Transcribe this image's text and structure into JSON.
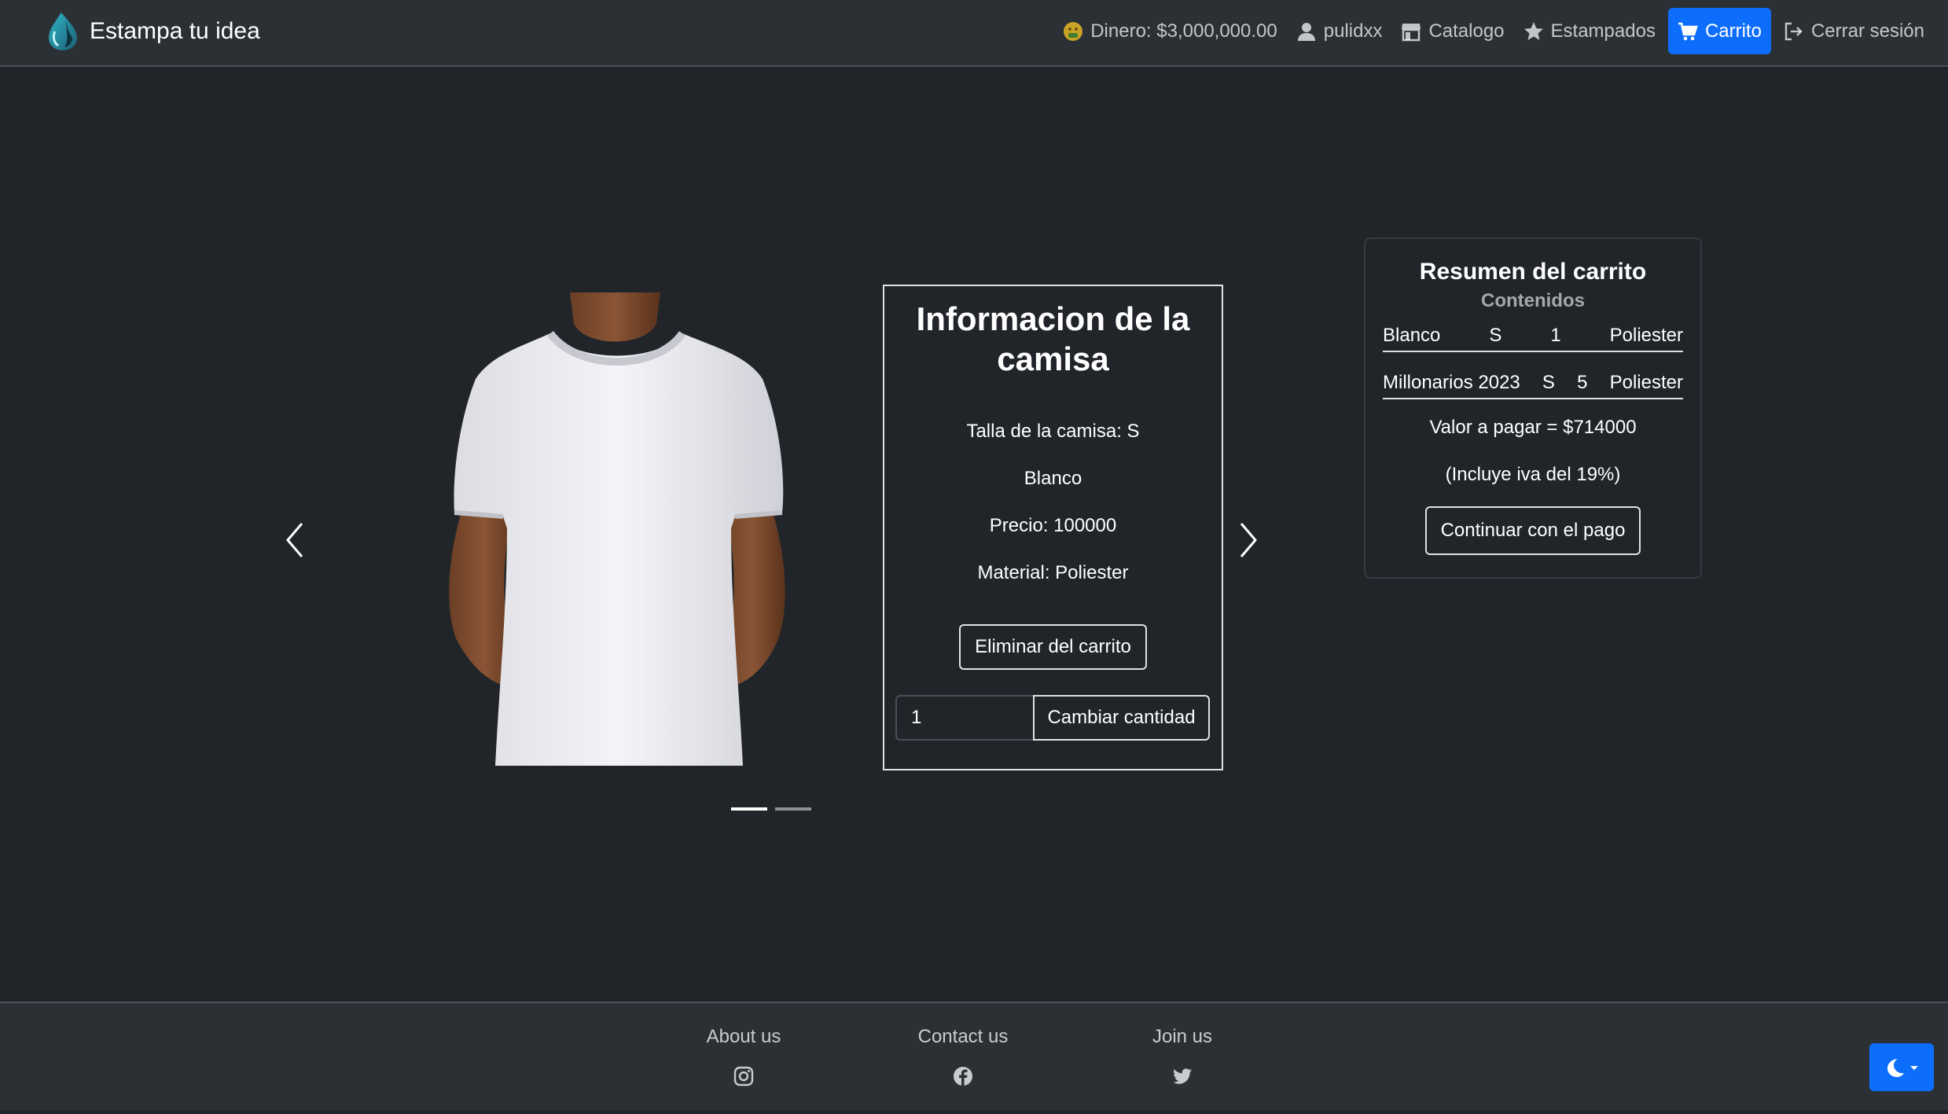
{
  "brand": {
    "name": "Estampa tu idea",
    "logo_icon": "water-drop-logo"
  },
  "nav": {
    "money": {
      "label": "Dinero: $3,000,000.00",
      "icon": "money-face-icon"
    },
    "user": {
      "label": "pulidxx",
      "icon": "person-icon"
    },
    "catalog": {
      "label": "Catalogo",
      "icon": "shop-icon"
    },
    "prints": {
      "label": "Estampados",
      "icon": "star-icon"
    },
    "cart": {
      "label": "Carrito",
      "icon": "cart-icon",
      "active": true
    },
    "logout": {
      "label": "Cerrar sesión",
      "icon": "logout-icon"
    }
  },
  "product": {
    "title": "Informacion de la camisa",
    "size_line": "Talla de la camisa: S",
    "color": "Blanco",
    "price_line": "Precio: 100000",
    "material_line": "Material: Poliester",
    "remove_button": "Eliminar del carrito",
    "quantity_value": "1",
    "change_quantity_button": "Cambiar cantidad"
  },
  "carousel": {
    "slide_count": 2,
    "active_index": 0
  },
  "summary": {
    "title": "Resumen del carrito",
    "subtitle": "Contenidos",
    "items": [
      {
        "name": "Blanco",
        "size": "S",
        "qty": "1",
        "material": "Poliester"
      },
      {
        "name": "Millonarios 2023",
        "size": "S",
        "qty": "5",
        "material": "Poliester"
      }
    ],
    "total": "Valor a pagar = $714000",
    "iva_note": "(Incluye iva del 19%)",
    "pay_button": "Continuar con el pago"
  },
  "footer": {
    "about": "About us",
    "contact": "Contact us",
    "join": "Join us",
    "icons": [
      "instagram-icon",
      "facebook-icon",
      "twitter-icon"
    ]
  },
  "colors": {
    "background": "#212529",
    "navbar": "#2b3035",
    "accent": "#0d6efd"
  }
}
